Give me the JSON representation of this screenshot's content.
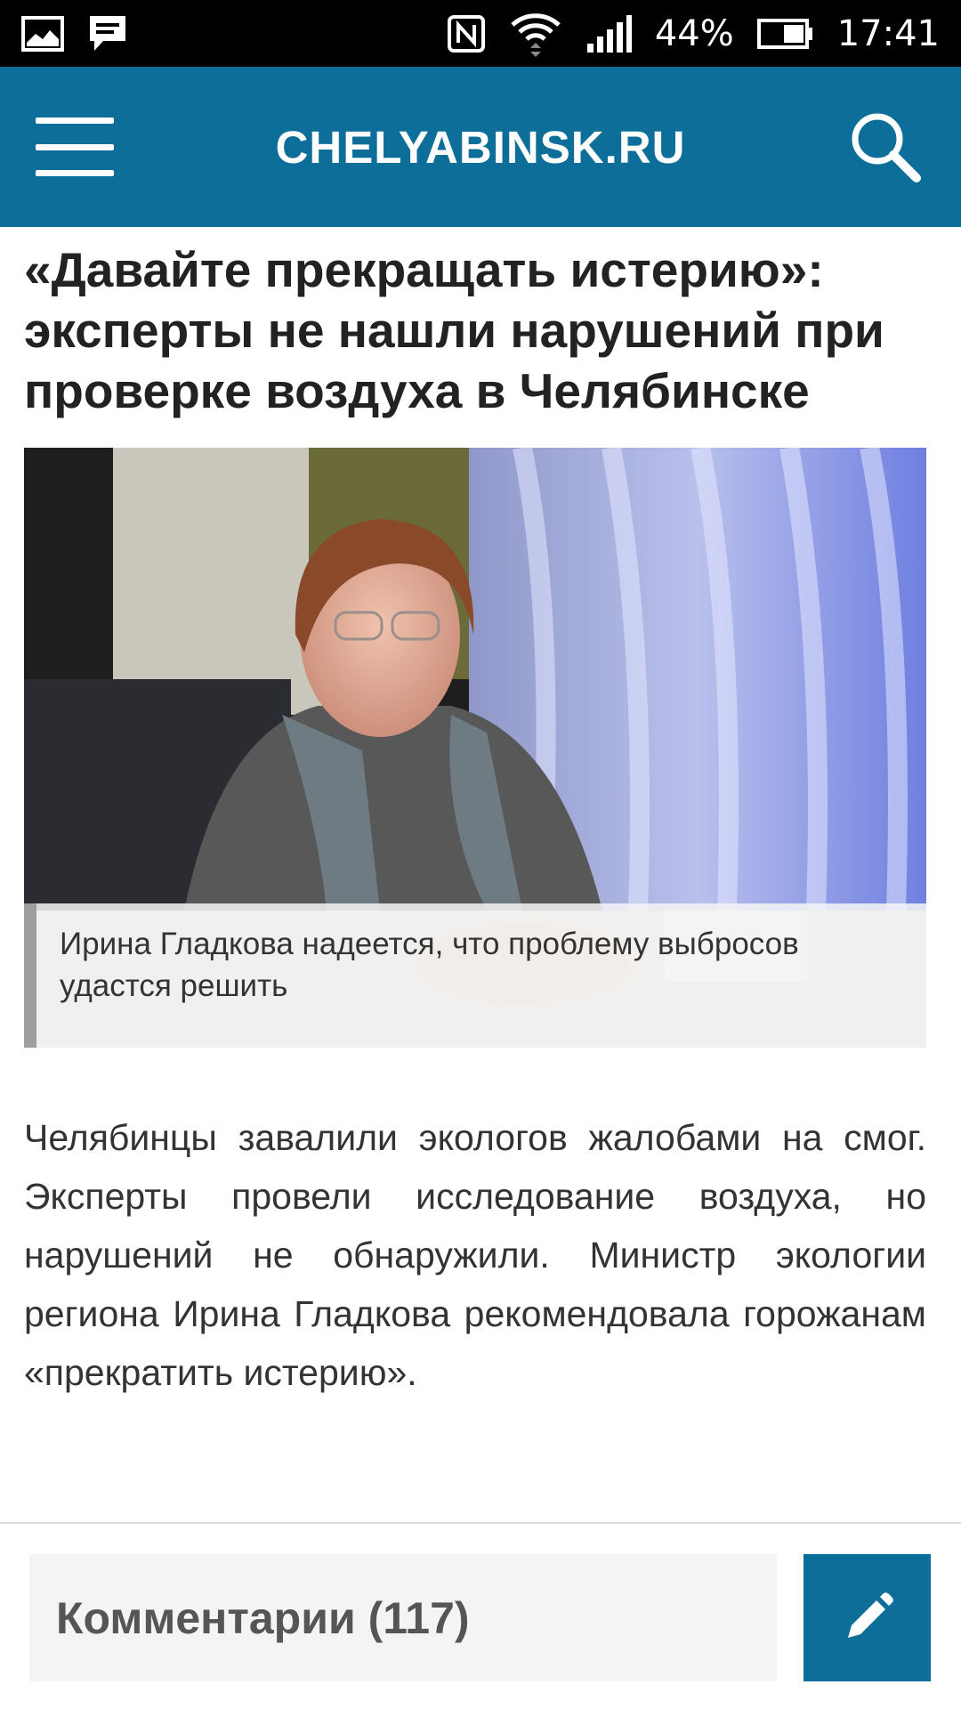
{
  "status_bar": {
    "battery": "44%",
    "time": "17:41",
    "icons": [
      "gallery-icon",
      "message-icon",
      "nfc-icon",
      "wifi-icon",
      "signal-icon",
      "battery-icon"
    ]
  },
  "header": {
    "site_title": "CHELYABINSK.RU",
    "menu_icon": "hamburger-menu-icon",
    "search_icon": "search-icon",
    "background_color": "#0d6f99"
  },
  "article": {
    "headline": "«Давайте прекращать истерию»: эксперты не нашли нарушений при проверке воздуха в Челябинске",
    "photo_caption": "Ирина Гладкова надеется, что проблему выбросов удастся решить",
    "lead": "Челябинцы завалили экологов жалобами на смог. Эксперты провели исследование воздуха, но нарушений не обнаружили. Министр экологии региона Ирина Гладкова рекомендовала горожанам «прекратить истерию»."
  },
  "bottom_bar": {
    "comments_label": "Комментарии (117)",
    "write_icon": "pencil-icon",
    "accent_color": "#0d6f99"
  }
}
